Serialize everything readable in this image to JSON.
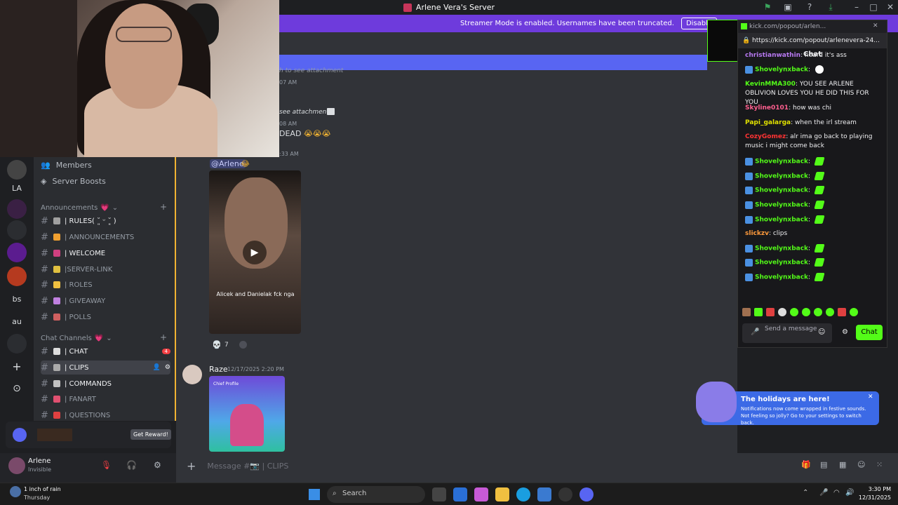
{
  "window": {
    "title": "Arlene Vera's Server"
  },
  "streamer_mode": {
    "text": "Streamer Mode is enabled. Usernames have been truncated.",
    "button": "Disable"
  },
  "server_sidebar": {
    "members_label": "Members",
    "boosts_label": "Server Boosts",
    "announcements_category": "Announcements",
    "chat_category": "Chat Channels",
    "channels": [
      {
        "name": "| RULES( ˘͈ ᵕ ˘͈ )",
        "color": "#f2f3f5"
      },
      {
        "name": "| ANNOUNCEMENTS",
        "color": "#949ba4"
      },
      {
        "name": "| WELCOME",
        "color": "#f2f3f5"
      },
      {
        "name": "|SERVER-LINK",
        "color": "#949ba4"
      },
      {
        "name": "| ROLES",
        "color": "#949ba4"
      },
      {
        "name": "| GIVEAWAY",
        "color": "#949ba4"
      },
      {
        "name": "| POLLS",
        "color": "#949ba4"
      }
    ],
    "chat_channels": [
      {
        "name": "| CHAT",
        "color": "#f2f3f5",
        "badge": "4"
      },
      {
        "name": "| CLIPS",
        "color": "#f2f3f5",
        "selected": true
      },
      {
        "name": "| COMMANDS",
        "color": "#f2f3f5"
      },
      {
        "name": "| FANART",
        "color": "#949ba4"
      },
      {
        "name": "| QUESTIONS",
        "color": "#949ba4"
      }
    ],
    "reward_label": "Get Reward!",
    "guild_labels": [
      "LA",
      "bs",
      "au"
    ]
  },
  "user_panel": {
    "name": "Arlene",
    "status": "Invisible"
  },
  "main": {
    "see_attachment": "see attachment",
    "ts1": "07 AM",
    "ts2": "08 AM",
    "ts3": ":33 AM",
    "dead_text": "DEAD",
    "mention": "@Arlene",
    "video_caption": "Alicek and Danielak fck nga",
    "reaction_count": "7",
    "raze_name": "Raze",
    "raze_time": "12/17/2025 2:20 PM",
    "raze_img_label": "Chief Profile",
    "message_placeholder": "Message #📷 | CLIPS",
    "holiday_title": "The holidays are here!",
    "holiday_body": "Notifications now come wrapped in festive sounds. Not feeling so jolly? Go to your settings to switch back.",
    "holiday_link": "festive sounds"
  },
  "popout": {
    "tab_title": "kick.com/popout/arlen...",
    "url": "https://kick.com/popout/arlenevera-24...",
    "header": "Chat",
    "messages": [
      {
        "user": "christianwathin",
        "text": "heard it's ass",
        "color": "#b879f2",
        "badge": false
      },
      {
        "user": "Shovelynxback",
        "text": "",
        "color": "#53fc18",
        "badge": true,
        "emote": "white"
      },
      {
        "user": "KevinMMA300",
        "text": "YOU SEE ARLENE OBLIVION LOVES YOU HE DID THIS FOR YOU",
        "color": "#53fc18",
        "badge": false
      },
      {
        "user": "Skyline0101",
        "text": "how was chi",
        "color": "#ff5f8f",
        "badge": false
      },
      {
        "user": "Papi_galarga",
        "text": "when the irl stream",
        "color": "#e0e000",
        "badge": false
      },
      {
        "user": "CozyGomez",
        "text": "alr ima go back to playing music i might come back",
        "color": "#ff3333",
        "badge": false
      },
      {
        "user": "Shovelynxback",
        "text": "",
        "color": "#53fc18",
        "badge": true,
        "emote": "green"
      },
      {
        "user": "Shovelynxback",
        "text": "",
        "color": "#53fc18",
        "badge": true,
        "emote": "green"
      },
      {
        "user": "Shovelynxback",
        "text": "",
        "color": "#53fc18",
        "badge": true,
        "emote": "green"
      },
      {
        "user": "Shovelynxback",
        "text": "",
        "color": "#53fc18",
        "badge": true,
        "emote": "green"
      },
      {
        "user": "Shovelynxback",
        "text": "",
        "color": "#53fc18",
        "badge": true,
        "emote": "green"
      },
      {
        "user": "slickzv",
        "text": "clips",
        "color": "#ff9a3c",
        "badge": false
      },
      {
        "user": "Shovelynxback",
        "text": "",
        "color": "#53fc18",
        "badge": true,
        "emote": "green"
      },
      {
        "user": "Shovelynxback",
        "text": "",
        "color": "#53fc18",
        "badge": true,
        "emote": "green"
      },
      {
        "user": "Shovelynxback",
        "text": "",
        "color": "#53fc18",
        "badge": true,
        "emote": "green"
      }
    ],
    "send_placeholder": "Send a message",
    "chat_button": "Chat"
  },
  "taskbar": {
    "weather_temp": "1 inch of rain",
    "weather_day": "Thursday",
    "search": "Search",
    "time": "3:30 PM",
    "date": "12/31/2025"
  }
}
